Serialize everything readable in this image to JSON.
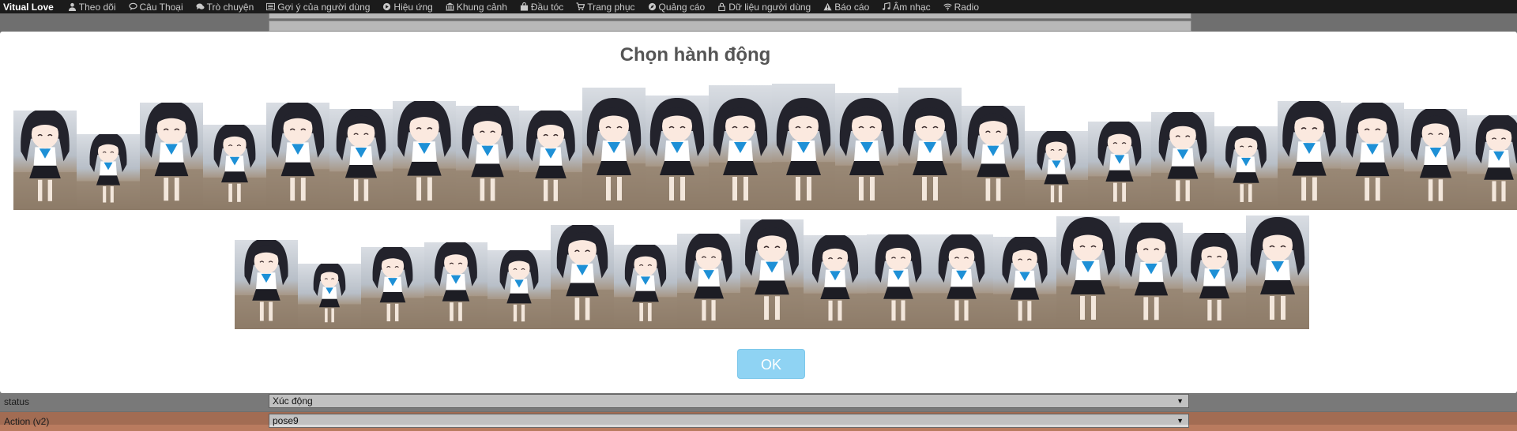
{
  "navbar": {
    "brand": "Vitual Love",
    "items": [
      {
        "label": "Theo dõi",
        "icon": "user-icon"
      },
      {
        "label": "Câu Thoại",
        "icon": "chat-bubble-icon"
      },
      {
        "label": "Trò chuyện",
        "icon": "comments-icon"
      },
      {
        "label": "Gợi ý của người dùng",
        "icon": "list-icon"
      },
      {
        "label": "Hiệu ứng",
        "icon": "circle-icon"
      },
      {
        "label": "Khung cảnh",
        "icon": "bank-icon"
      },
      {
        "label": "Đầu tóc",
        "icon": "bag-icon"
      },
      {
        "label": "Trang phục",
        "icon": "cart-icon"
      },
      {
        "label": "Quảng cáo",
        "icon": "compass-icon"
      },
      {
        "label": "Dữ liệu người dùng",
        "icon": "lock-icon"
      },
      {
        "label": "Báo cáo",
        "icon": "warning-icon"
      },
      {
        "label": "Âm nhạc",
        "icon": "music-icon"
      },
      {
        "label": "Radio",
        "icon": "wifi-icon"
      }
    ]
  },
  "modal": {
    "title": "Chọn hành động",
    "ok_label": "OK"
  },
  "background_form": {
    "rows": [
      {
        "label": "status",
        "value": "Xúc động",
        "highlight": false
      },
      {
        "label": "Action (v2)",
        "value": "pose9",
        "highlight": true
      }
    ]
  },
  "colors": {
    "ok_button": "#8fd3f3",
    "navbar": "#1b1b1b",
    "row_highlight": "#b97b5f"
  }
}
